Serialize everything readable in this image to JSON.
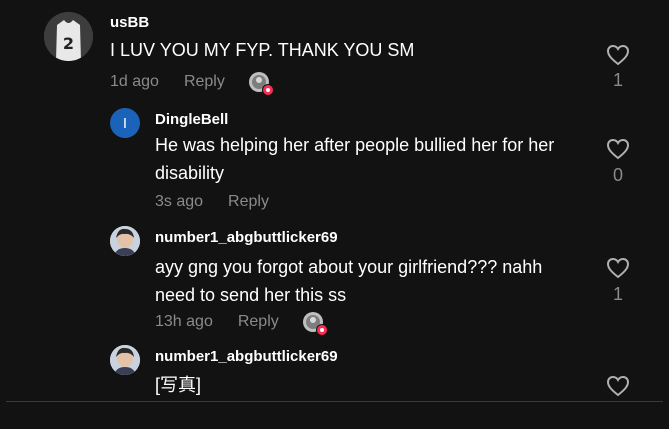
{
  "comments": [
    {
      "username": "usBB",
      "text": "I LUV YOU MY FYP. THANK YOU SM",
      "time": "1d ago",
      "reply": "Reply",
      "likes": "1",
      "avatar_icon": "jersey-number-2-avatar"
    },
    {
      "username": "DingleBell",
      "text": "He was helping her after people bullied her for her disability",
      "time": "3s ago",
      "reply": "Reply",
      "likes": "0",
      "avatar_letter": "I",
      "avatar_color": "#1a63b8"
    },
    {
      "username": "number1_abgbuttlicker69",
      "text": "ayy gng you forgot about your girlfriend??? nahh need to send her this ss",
      "time": "13h ago",
      "reply": "Reply",
      "likes": "1",
      "avatar_icon": "person-photo-avatar"
    },
    {
      "username": "number1_abgbuttlicker69",
      "text": "[写真]",
      "avatar_icon": "person-photo-avatar"
    }
  ],
  "colors": {
    "background": "#121212",
    "secondary_text": "#8a8a8a",
    "like_badge": "#fe2c55"
  }
}
